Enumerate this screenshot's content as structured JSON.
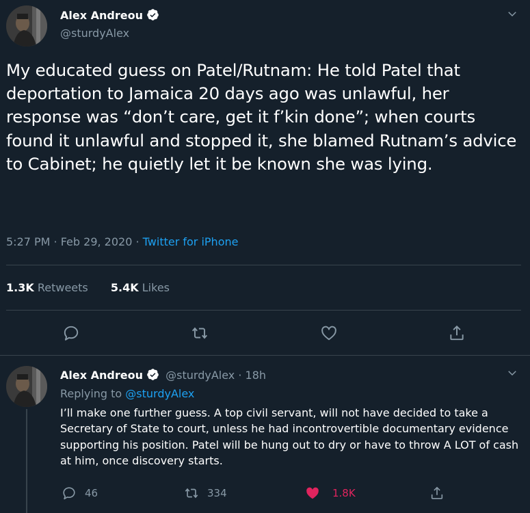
{
  "main_tweet": {
    "author_name": "Alex Andreou",
    "author_handle": "@sturdyAlex",
    "text": "My educated guess on Patel/Rutnam: He told Patel that deportation to Jamaica 20 days ago was unlawful, her response was “don’t care, get it f’kin done”; when courts found it unlawful and stopped it, she blamed Rutnam’s advice to Cabinet; he quietly let it be known she was lying.",
    "time": "5:27 PM · Feb 29, 2020 · ",
    "source": "Twitter for iPhone",
    "retweets_count": "1.3K",
    "retweets_label": " Retweets",
    "likes_count": "5.4K",
    "likes_label": " Likes",
    "icons": {
      "reply": "reply-icon",
      "retweet": "retweet-icon",
      "like": "heart-icon",
      "share": "share-icon",
      "menu": "chevron-down-icon"
    }
  },
  "reply_tweet": {
    "author_name": "Alex Andreou",
    "author_handle_time": "@sturdyAlex · 18h",
    "replying_prefix": "Replying to ",
    "replying_to": "@sturdyAlex",
    "text": "I’ll make one further guess. A top civil servant, will not have decided to take a Secretary of State to court, unless he had incontrovertible documentary evidence supporting his position. Patel will be hung out to dry or have to throw A LOT of cash at him, once discovery starts.",
    "reply_count": "46",
    "retweet_count": "334",
    "like_count": "1.8K",
    "liked": true
  },
  "colors": {
    "background": "#15202b",
    "text": "#ffffff",
    "muted": "#8899a6",
    "link": "#1da1f2",
    "like": "#e0245e",
    "border": "#38444d"
  }
}
